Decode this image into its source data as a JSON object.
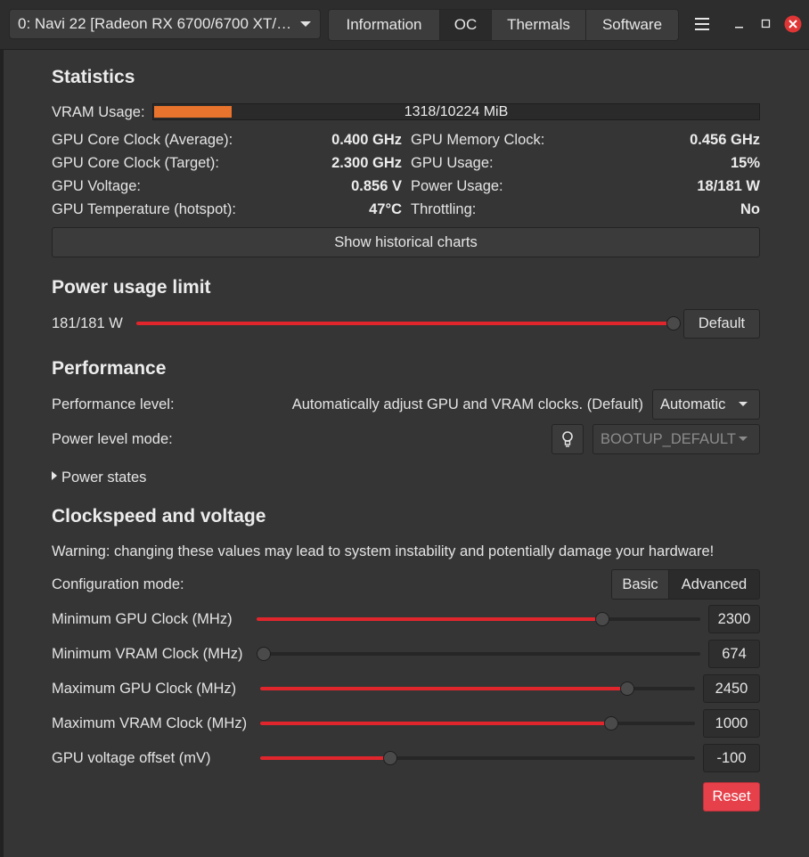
{
  "header": {
    "gpu_selector": "0: Navi 22 [Radeon RX 6700/6700 XT/…",
    "tabs": [
      {
        "label": "Information",
        "active": false
      },
      {
        "label": "OC",
        "active": true
      },
      {
        "label": "Thermals",
        "active": false
      },
      {
        "label": "Software",
        "active": false
      }
    ],
    "close_color": "#e03535"
  },
  "statistics": {
    "title": "Statistics",
    "vram_label": "VRAM Usage:",
    "vram_text": "1318/10224 MiB",
    "vram_fraction": 0.129,
    "vram_color": "#e8732d",
    "left": [
      {
        "label": "GPU Core Clock (Average):",
        "value": "0.400 GHz"
      },
      {
        "label": "GPU Core Clock (Target):",
        "value": "2.300 GHz"
      },
      {
        "label": "GPU Voltage:",
        "value": "0.856 V"
      },
      {
        "label": "GPU Temperature (hotspot):",
        "value": "47°C"
      }
    ],
    "right": [
      {
        "label": "GPU Memory Clock:",
        "value": "0.456 GHz"
      },
      {
        "label": "GPU Usage:",
        "value": "15%"
      },
      {
        "label": "Power Usage:",
        "value": "18/181 W"
      },
      {
        "label": "Throttling:",
        "value": "No"
      }
    ],
    "charts_button": "Show historical charts"
  },
  "power_limit": {
    "title": "Power usage limit",
    "value_text": "181/181 W",
    "fraction": 1.0,
    "default_button": "Default"
  },
  "performance": {
    "title": "Performance",
    "level_label": "Performance level:",
    "level_description": "Automatically adjust GPU and VRAM clocks. (Default)",
    "level_value": "Automatic",
    "mode_label": "Power level mode:",
    "mode_value": "BOOTUP_DEFAULT",
    "power_states": "Power states"
  },
  "clockspeed": {
    "title": "Clockspeed and voltage",
    "warning": "Warning: changing these values may lead to system instability and potentially damage your hardware!",
    "config_label": "Configuration mode:",
    "config_options": [
      "Basic",
      "Advanced"
    ],
    "config_selected": "Advanced",
    "sliders": [
      {
        "label": "Minimum GPU Clock (MHz)",
        "value": "2300",
        "fraction": 0.78
      },
      {
        "label": "Minimum VRAM Clock (MHz)",
        "value": "674",
        "fraction": 0.0
      },
      {
        "label": "Maximum GPU Clock (MHz)",
        "value": "2450",
        "fraction": 0.845
      },
      {
        "label": "Maximum VRAM Clock (MHz)",
        "value": "1000",
        "fraction": 0.808
      },
      {
        "label": "GPU voltage offset (mV)",
        "value": "-100",
        "fraction": 0.3
      }
    ],
    "reset_button": "Reset",
    "reset_color": "#e6404a",
    "slider_color": "#e0262c"
  }
}
